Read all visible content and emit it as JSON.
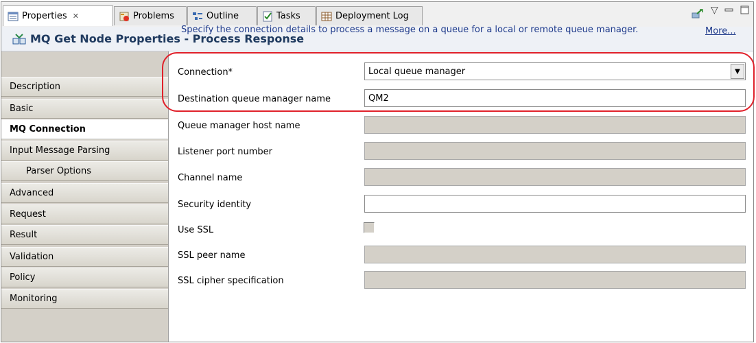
{
  "tabs": [
    {
      "label": "Properties",
      "close": "✕",
      "icon": "properties-icon"
    },
    {
      "label": "Problems",
      "icon": "problems-icon"
    },
    {
      "label": "Outline",
      "icon": "outline-icon"
    },
    {
      "label": "Tasks",
      "icon": "tasks-icon"
    },
    {
      "label": "Deployment Log",
      "icon": "deployment-log-icon"
    }
  ],
  "window_controls": {
    "menu": "▽",
    "minimize": "▭",
    "maximize": "☐"
  },
  "title": "MQ Get Node Properties - Process Response",
  "nav": [
    {
      "label": "Description"
    },
    {
      "label": "Basic"
    },
    {
      "label": "MQ Connection",
      "selected": true
    },
    {
      "label": "Input Message Parsing"
    },
    {
      "label": "Parser Options",
      "sub": true
    },
    {
      "label": "Advanced"
    },
    {
      "label": "Request"
    },
    {
      "label": "Result"
    },
    {
      "label": "Validation"
    },
    {
      "label": "Policy"
    },
    {
      "label": "Monitoring"
    }
  ],
  "description": "Specify the connection details to process a message on a queue for a local or remote queue manager.",
  "more_link": "More...",
  "fields": {
    "connection": {
      "label": "Connection*",
      "value": "Local queue manager"
    },
    "dest_qmgr": {
      "label": "Destination queue manager name",
      "value": "QM2"
    },
    "qmgr_host": {
      "label": "Queue manager host name",
      "value": ""
    },
    "listener_port": {
      "label": "Listener port number",
      "value": ""
    },
    "channel": {
      "label": "Channel name",
      "value": ""
    },
    "security_identity": {
      "label": "Security identity",
      "value": ""
    },
    "use_ssl": {
      "label": "Use SSL",
      "checked": false
    },
    "ssl_peer": {
      "label": "SSL peer name",
      "value": ""
    },
    "ssl_cipher": {
      "label": "SSL cipher specification",
      "value": ""
    }
  },
  "colors": {
    "highlight": "#e0202a",
    "link": "#1f3a8a",
    "title": "#1f3a5f"
  }
}
